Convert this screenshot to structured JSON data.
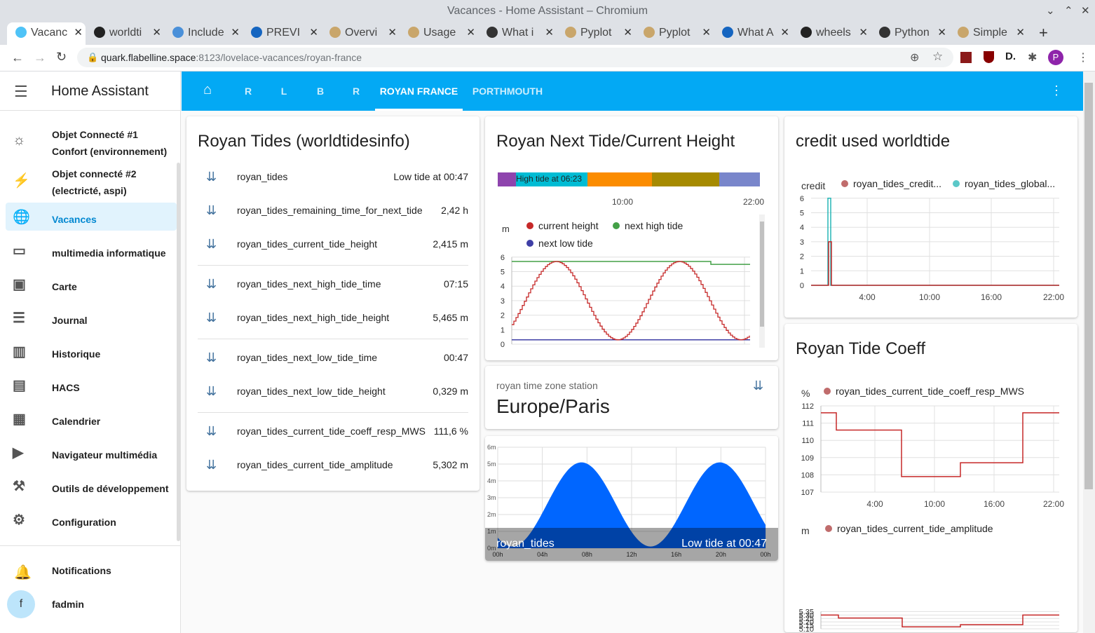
{
  "browser": {
    "window_title": "Vacances - Home Assistant – Chromium",
    "tabs": [
      "Vacanc",
      "worldti",
      "Include",
      "PREVI",
      "Overvi",
      "Usage",
      "What i",
      "Pyplot",
      "Pyplot",
      "What A",
      "wheels",
      "Python",
      "Simple"
    ],
    "url_host": "quark.flabelline.space",
    "url_path": ":8123/lovelace-vacances/royan-france"
  },
  "sidebar": {
    "app_title": "Home Assistant",
    "items": [
      {
        "label": "Objet Connecté #1",
        "label2": "Confort (environnement)",
        "icon": "home-thermo-icon"
      },
      {
        "label": "Objet connecté #2",
        "label2": "(electricté, aspi)",
        "icon": "flash-icon"
      },
      {
        "label": "Vacances",
        "icon": "globe-icon"
      },
      {
        "label": "multimedia informatique",
        "icon": "monitor-icon"
      },
      {
        "label": "Carte",
        "icon": "account-box-icon"
      },
      {
        "label": "Journal",
        "icon": "list-icon"
      },
      {
        "label": "Historique",
        "icon": "chart-bar-icon"
      },
      {
        "label": "HACS",
        "icon": "hacs-icon"
      },
      {
        "label": "Calendrier",
        "icon": "calendar-icon"
      },
      {
        "label": "Navigateur multimédia",
        "icon": "play-box-icon"
      },
      {
        "label": "Outils de développement",
        "icon": "hammer-icon"
      },
      {
        "label": "Configuration",
        "icon": "cog-icon"
      }
    ],
    "notifications": "Notifications",
    "user": "fadmin",
    "user_initial": "f"
  },
  "header": {
    "tabs": [
      "R",
      "L",
      "B",
      "R",
      "ROYAN FRANCE",
      "PORTHMOUTH"
    ]
  },
  "tides_card": {
    "title": "Royan Tides (worldtidesinfo)",
    "rows": [
      {
        "name": "royan_tides",
        "value": "Low tide at 00:47"
      },
      {
        "name": "royan_tides_remaining_time_for_next_tide",
        "value": "2,42 h"
      },
      {
        "name": "royan_tides_current_tide_height",
        "value": "2,415 m"
      },
      {
        "name": "royan_tides_next_high_tide_time",
        "value": "07:15"
      },
      {
        "name": "royan_tides_next_high_tide_height",
        "value": "5,465 m"
      },
      {
        "name": "royan_tides_next_low_tide_time",
        "value": "00:47"
      },
      {
        "name": "royan_tides_next_low_tide_height",
        "value": "0,329 m"
      },
      {
        "name": "royan_tides_current_tide_coeff_resp_MWS",
        "value": "111,6 %"
      },
      {
        "name": "royan_tides_current_tide_amplitude",
        "value": "5,302 m"
      }
    ]
  },
  "next_tide_card": {
    "title": "Royan Next Tide/Current Height",
    "timeline_label": "High tide at 06:23",
    "timeline_ticks": [
      "10:00",
      "22:00"
    ],
    "unit": "m",
    "legend": [
      "current height",
      "next high tide",
      "next low tide"
    ],
    "colors": {
      "current": "#c62828",
      "high": "#43a047",
      "low": "#3f3fa6"
    }
  },
  "tz_card": {
    "label": "royan time zone station",
    "value": "Europe/Paris"
  },
  "picture_card": {
    "name": "royan_tides",
    "state": "Low tide at 00:47"
  },
  "credit_card": {
    "title": "credit used worldtide",
    "unit": "credit",
    "legend": [
      "royan_tides_credit...",
      "royan_tides_global..."
    ]
  },
  "coeff_card": {
    "title": "Royan Tide Coeff",
    "unit": "%",
    "legend": "royan_tides_current_tide_coeff_resp_MWS",
    "amp_unit": "m",
    "amp_legend": "royan_tides_current_tide_amplitude"
  },
  "chart_data": [
    {
      "type": "line",
      "title": "",
      "ylabel": "m",
      "ylim": [
        0,
        6
      ],
      "series": [
        {
          "name": "current height",
          "x": [
            "~0h",
            "~6h",
            "~13h",
            "~19h",
            "~24h"
          ],
          "values": [
            1.3,
            5.7,
            0.3,
            5.7,
            2.4
          ]
        },
        {
          "name": "next high tide",
          "values": [
            5.7,
            5.5
          ]
        },
        {
          "name": "next low tide",
          "values": [
            0.3,
            0.3
          ]
        }
      ]
    },
    {
      "type": "line",
      "title": "",
      "ylabel": "credit",
      "ylim": [
        0,
        6
      ],
      "x": [
        "4:00",
        "10:00",
        "16:00",
        "22:00"
      ],
      "series": [
        {
          "name": "royan_tides_credit...",
          "peak": 3
        },
        {
          "name": "royan_tides_global...",
          "peak": 6
        }
      ]
    },
    {
      "type": "line",
      "title": "",
      "ylabel": "%",
      "ylim": [
        107,
        112
      ],
      "x": [
        "4:00",
        "10:00",
        "16:00",
        "22:00"
      ],
      "series": [
        {
          "name": "royan_tides_current_tide_coeff_resp_MWS",
          "values": [
            111.6,
            110.6,
            107.9,
            108.7,
            111.6
          ]
        }
      ]
    },
    {
      "type": "line",
      "title": "",
      "ylabel": "m",
      "ylim": [
        5.1,
        5.35
      ],
      "series": [
        {
          "name": "royan_tides_current_tide_amplitude",
          "values": [
            5.3,
            5.256,
            5.128,
            5.16,
            5.3
          ]
        }
      ]
    },
    {
      "type": "area",
      "title": "",
      "x": [
        "00h",
        "04h",
        "08h",
        "12h",
        "16h",
        "20h",
        "00h"
      ],
      "ylim": [
        0,
        6
      ],
      "values": [
        0.5,
        3,
        5.5,
        3,
        0.5,
        3,
        5.5,
        3,
        0.3
      ]
    }
  ]
}
